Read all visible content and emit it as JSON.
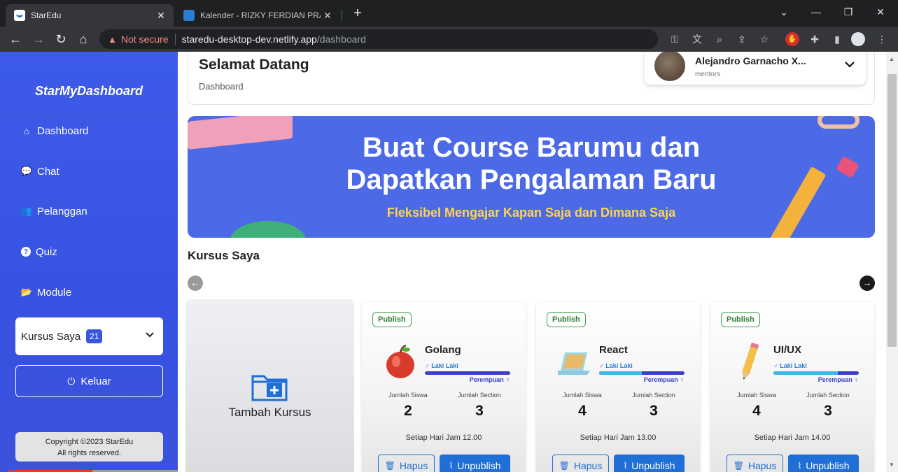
{
  "browser": {
    "tabs": [
      {
        "title": "StarEdu",
        "active": true
      },
      {
        "title": "Kalender - RIZKY FERDIAN PRASE",
        "active": false
      }
    ],
    "security_label": "Not secure",
    "url_host": "staredu-desktop-dev.netlify.app",
    "url_path": "/dashboard"
  },
  "sidebar": {
    "brand": "StarMyDashboard",
    "items": [
      {
        "label": "Dashboard",
        "icon": "home-icon"
      },
      {
        "label": "Chat",
        "icon": "chat-icon"
      },
      {
        "label": "Pelanggan",
        "icon": "users-icon"
      },
      {
        "label": "Quiz",
        "icon": "question-icon"
      },
      {
        "label": "Module",
        "icon": "folder-icon"
      }
    ],
    "select": {
      "label": "Kursus Saya",
      "badge": "21"
    },
    "logout_label": "Keluar",
    "copyright_line1": "Copyright ©2023 StarEdu",
    "copyright_line2": "All rights reserved."
  },
  "header": {
    "title": "Selamat Datang",
    "breadcrumb": "Dashboard",
    "user": {
      "name": "Alejandro Garnacho X...",
      "role": "mentors"
    }
  },
  "banner": {
    "title_line1": "Buat Course Barumu dan",
    "title_line2": "Dapatkan Pengalaman Baru",
    "subtitle": "Fleksibel Mengajar Kapan Saja dan Dimana Saja"
  },
  "courses_section": {
    "title": "Kursus Saya",
    "add_label": "Tambah Kursus",
    "male_label": "♂ Laki Laki",
    "female_label": "Perempuan ♀",
    "students_label": "Jumlah Siswa",
    "sections_label": "Jumlah Section",
    "delete_label": "Hapus",
    "unpublish_label": "Unpublish",
    "courses": [
      {
        "status": "Publish",
        "name": "Golang",
        "students": "2",
        "sections": "3",
        "schedule": "Setiap Hari Jam 12.00",
        "male_ratio": 0.0,
        "icon": "apple-icon"
      },
      {
        "status": "Publish",
        "name": "React",
        "students": "4",
        "sections": "3",
        "schedule": "Setiap Hari Jam 13.00",
        "male_ratio": 0.5,
        "icon": "laptop-icon"
      },
      {
        "status": "Publish",
        "name": "UI/UX",
        "students": "4",
        "sections": "3",
        "schedule": "Setiap Hari Jam 14.00",
        "male_ratio": 0.75,
        "icon": "pencil-icon"
      }
    ]
  }
}
